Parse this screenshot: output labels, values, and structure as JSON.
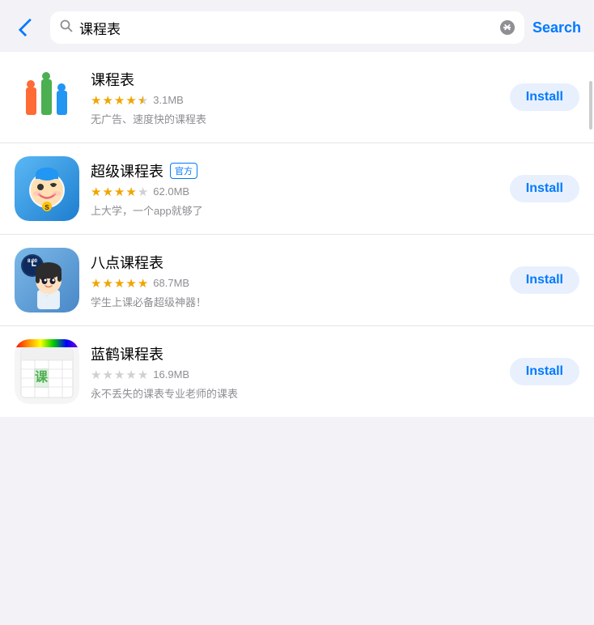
{
  "header": {
    "back_label": "back",
    "search_query": "课程表",
    "search_placeholder": "课程表",
    "search_button_label": "Search",
    "clear_label": "×"
  },
  "apps": [
    {
      "id": "kechengbiao",
      "name": "课程表",
      "official": false,
      "rating": 4.5,
      "stars_filled": 4,
      "stars_half": 1,
      "stars_empty": 0,
      "size": "3.1MB",
      "description": "无广告、速度快的课程表",
      "install_label": "Install",
      "icon_type": "kechengbiao"
    },
    {
      "id": "super-kechengbiao",
      "name": "超级课程表",
      "official": true,
      "official_text": "官方",
      "rating": 4.0,
      "stars_filled": 4,
      "stars_half": 0,
      "stars_empty": 1,
      "size": "62.0MB",
      "description": "上大学，一个app就够了",
      "install_label": "Install",
      "icon_type": "super"
    },
    {
      "id": "badian-kechengbiao",
      "name": "八点课程表",
      "official": false,
      "rating": 5.0,
      "stars_filled": 5,
      "stars_half": 0,
      "stars_empty": 0,
      "size": "68.7MB",
      "description": "学生上课必备超级神器！",
      "install_label": "Install",
      "icon_type": "badian"
    },
    {
      "id": "lanhe-kechengbiao",
      "name": "蓝鹤课程表",
      "official": false,
      "rating": 0,
      "stars_filled": 0,
      "stars_half": 0,
      "stars_empty": 5,
      "size": "16.9MB",
      "description": "永不丢失的课表专业老师的课表",
      "install_label": "Install",
      "icon_type": "lanhe"
    }
  ],
  "colors": {
    "accent": "#007aff",
    "star": "#f0a500",
    "star_empty": "#d0d0d0",
    "install_bg": "#e8f0fe",
    "text_secondary": "#8e8e93"
  }
}
